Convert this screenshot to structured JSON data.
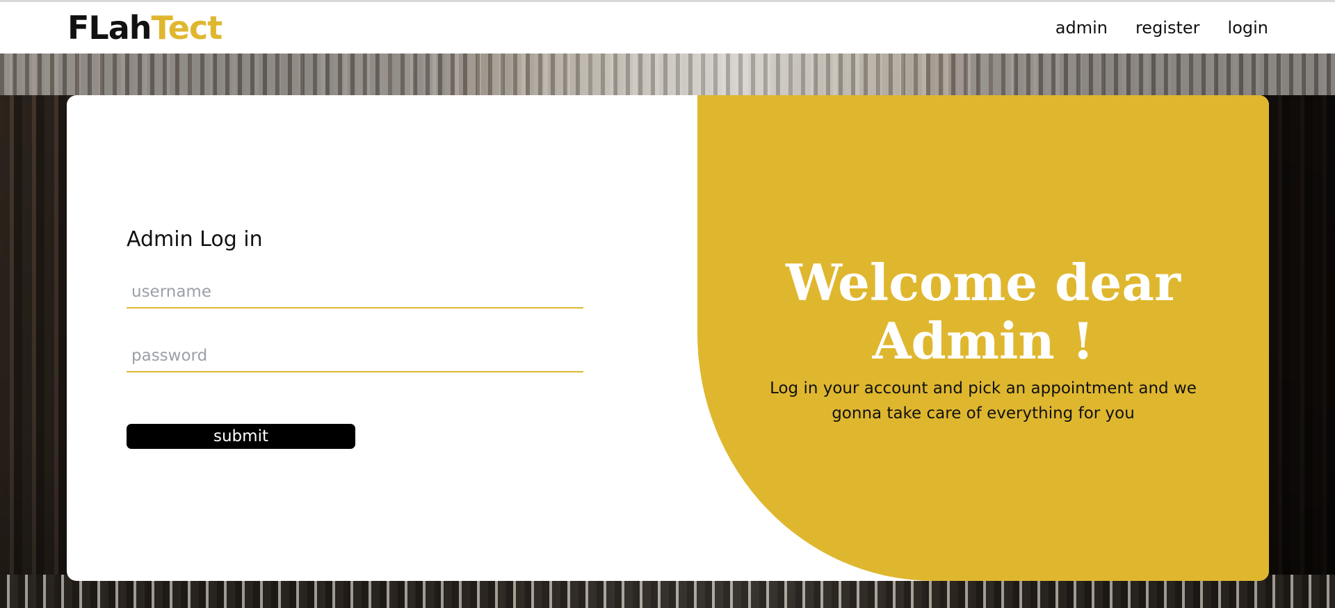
{
  "brand": {
    "part1": "FLah",
    "part2": "Tect",
    "color_part1": "#111111",
    "color_part2": "#dfb72f"
  },
  "nav": {
    "items": [
      {
        "label": "admin"
      },
      {
        "label": "register"
      },
      {
        "label": "login"
      }
    ]
  },
  "form": {
    "title": "Admin Log in",
    "username": {
      "value": "",
      "placeholder": "username"
    },
    "password": {
      "value": "",
      "placeholder": "password"
    },
    "submit_label": "submit"
  },
  "welcome": {
    "title": "Welcome dear Admin !",
    "text": "Log in your account and pick an appointment and we gonna take care of everything for you"
  },
  "colors": {
    "accent": "#dfb72f",
    "button": "#000000",
    "panel": "#ffffff"
  }
}
